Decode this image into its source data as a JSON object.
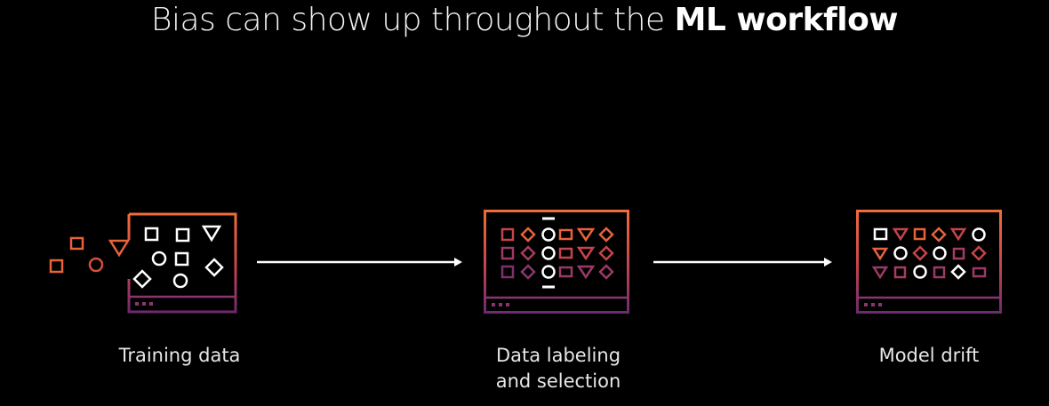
{
  "title": {
    "prefix": "Bias can show up throughout the ",
    "emphasis": "ML workflow"
  },
  "stages": [
    {
      "lines": [
        "Training data"
      ]
    },
    {
      "lines": [
        "Data labeling",
        "and selection"
      ]
    },
    {
      "lines": [
        "Model drift"
      ]
    }
  ],
  "colors": {
    "background": "#000000",
    "frame_gradient": [
      "#f06a3c",
      "#7a2a6a"
    ],
    "icon_white": "#ffffff",
    "icon_orange": "#e8623a",
    "icon_purple": "#8a3572",
    "arrow": "#ffffff"
  }
}
